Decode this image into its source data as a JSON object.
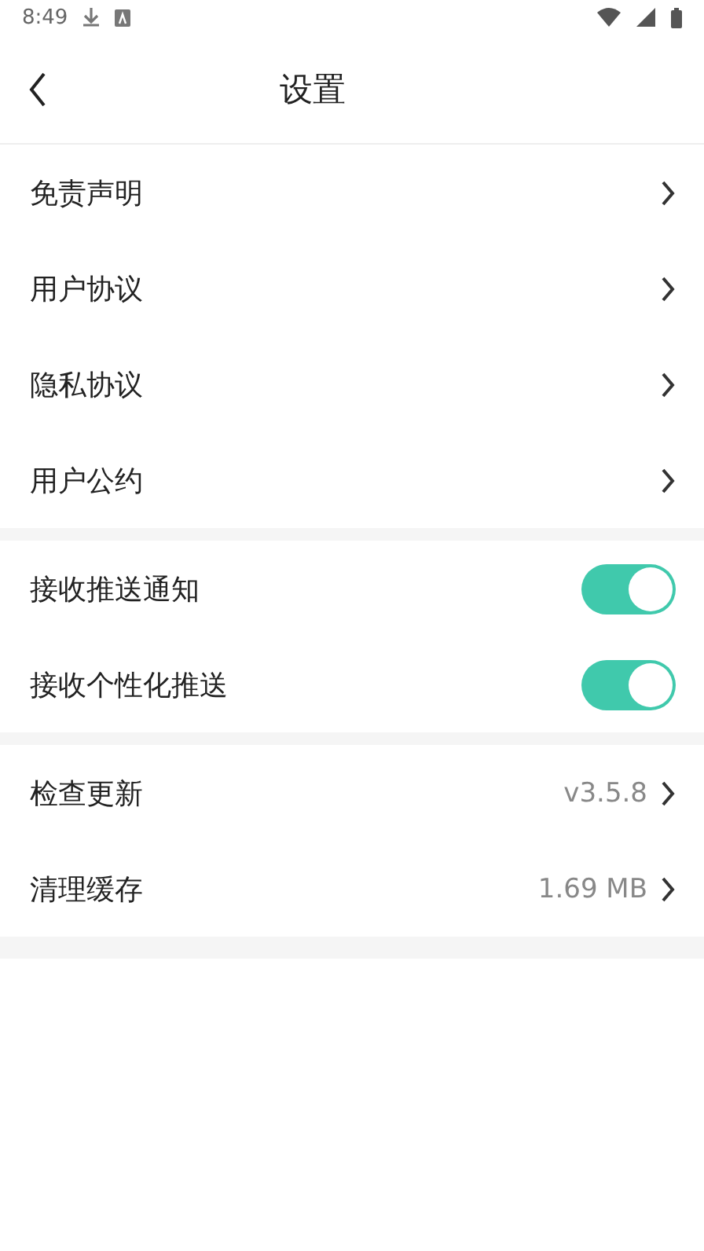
{
  "status_bar": {
    "time": "8:49"
  },
  "header": {
    "title": "设置"
  },
  "sections": [
    {
      "items": [
        {
          "kind": "link",
          "label": "免责声明"
        },
        {
          "kind": "link",
          "label": "用户协议"
        },
        {
          "kind": "link",
          "label": "隐私协议"
        },
        {
          "kind": "link",
          "label": "用户公约"
        }
      ]
    },
    {
      "items": [
        {
          "kind": "toggle",
          "label": "接收推送通知",
          "on": true
        },
        {
          "kind": "toggle",
          "label": "接收个性化推送",
          "on": true
        }
      ]
    },
    {
      "items": [
        {
          "kind": "value",
          "label": "检查更新",
          "value": "v3.5.8"
        },
        {
          "kind": "value",
          "label": "清理缓存",
          "value": "1.69 MB"
        }
      ]
    }
  ]
}
